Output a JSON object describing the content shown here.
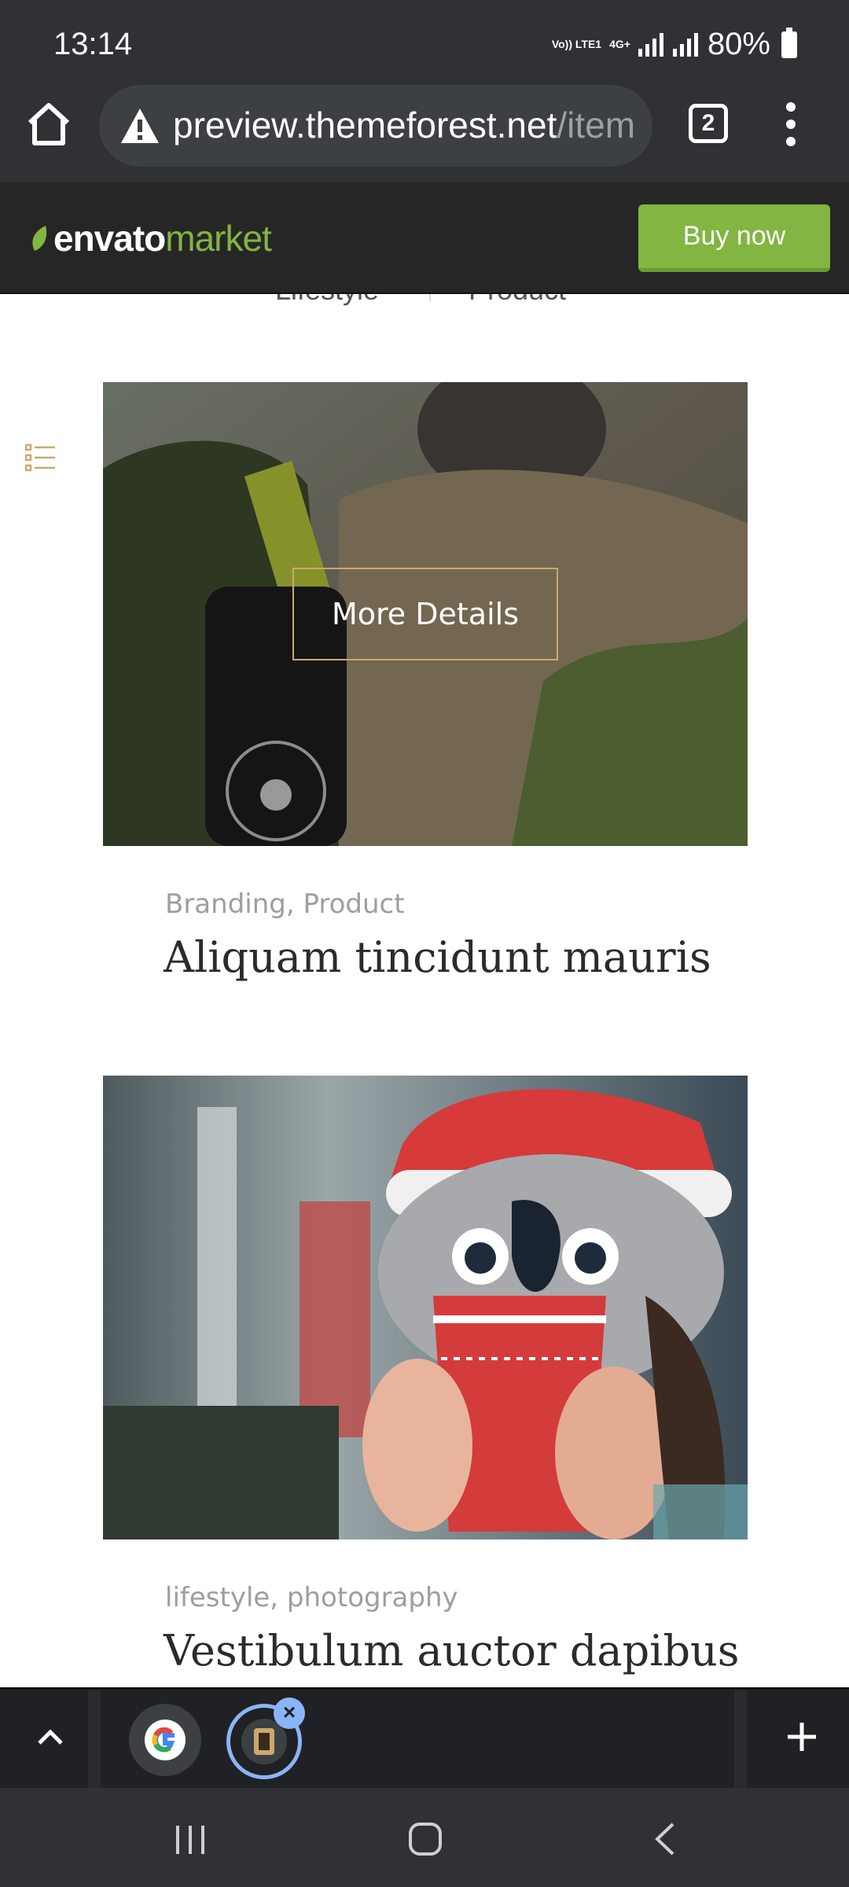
{
  "status_bar": {
    "time": "13:14",
    "network_label_top": "Vo)) LTE1",
    "network_type": "4G+",
    "battery": "80%"
  },
  "browser": {
    "url_main": "preview.themeforest.net",
    "url_rest": "/item",
    "tab_count": "2"
  },
  "envato_bar": {
    "logo_part1": "envato",
    "logo_part2": "market",
    "buy_label": "Buy now",
    "brand_color": "#82b541"
  },
  "filters": {
    "item_a": "Lifestyle",
    "item_b": "Product"
  },
  "portfolio": [
    {
      "categories": "Branding, Product",
      "title": "Aliquam tincidunt mauris",
      "overlay_label": "More Details"
    },
    {
      "categories": "lifestyle, photography",
      "title": "Vestibulum auctor dapibus"
    }
  ],
  "tab_strip": {
    "close_label": "×"
  }
}
